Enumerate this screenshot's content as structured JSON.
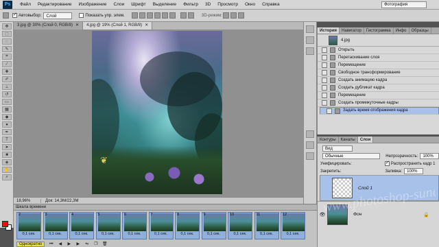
{
  "app": {
    "logo": "Ps"
  },
  "menu": [
    "Файл",
    "Редактирование",
    "Изображение",
    "Слои",
    "Шрифт",
    "Выделение",
    "Фильтр",
    "3D",
    "Просмотр",
    "Окно",
    "Справка"
  ],
  "workspace": "Фотография",
  "options": {
    "autoselect_label": "Автовыбор:",
    "autoselect_value": "Слой",
    "show_controls_label": "Показать упр. элем.",
    "mode3d": "3D-режим:"
  },
  "doc_tabs": [
    {
      "label": "3.jpg @ 30% (Слой 0, RGB/8)"
    },
    {
      "label": "4.jpg @ 19% (Слой 1, RGB/8)"
    }
  ],
  "status": {
    "zoom": "18,96%",
    "doc": "Док: 14,3M/22,3M"
  },
  "timeline": {
    "title": "Шкала времени",
    "frames": [
      {
        "num": "2",
        "time": "0,1 сек."
      },
      {
        "num": "3",
        "time": "0,1 сек."
      },
      {
        "num": "4",
        "time": "0,1 сек."
      },
      {
        "num": "5",
        "time": "0,1 сек."
      },
      {
        "num": "6",
        "time": "0,1 сек."
      },
      {
        "num": "7",
        "time": "0,1 сек."
      },
      {
        "num": "8",
        "time": "0,1 сек."
      },
      {
        "num": "9",
        "time": "0,1 сек."
      },
      {
        "num": "10",
        "time": "0,1 сек."
      },
      {
        "num": "11",
        "time": "0,1 сек."
      },
      {
        "num": "12",
        "time": "0,1 сек."
      }
    ],
    "loop": "Однократно"
  },
  "history": {
    "tabs": [
      "История",
      "Навигатор",
      "Гистограмма",
      "Инфо",
      "Образцы"
    ],
    "snapshot": "4.jpg",
    "items": [
      "Открыть",
      "Перетаскивание слоя",
      "Перемещение",
      "Свободное трансформирование",
      "Создать анимацию кадра",
      "Создать дубликат кадра",
      "Перемещение",
      "Создать промежуточные кадры",
      "Задать время отображения кадра"
    ]
  },
  "layers": {
    "tabs": [
      "Контуры",
      "Каналы",
      "Слои"
    ],
    "kind": "Вид",
    "blend": "Обычные",
    "opacity_label": "Непрозрачность:",
    "opacity": "100%",
    "unify_label": "Унифицировать:",
    "propagate_label": "Распространить кадр 1",
    "lock_label": "Закрепить:",
    "fill_label": "Заливка:",
    "fill": "100%",
    "list": [
      {
        "name": "Слой 1"
      },
      {
        "name": "Фон"
      }
    ]
  },
  "watermark": "www.photoshop-sunduchok.ru"
}
